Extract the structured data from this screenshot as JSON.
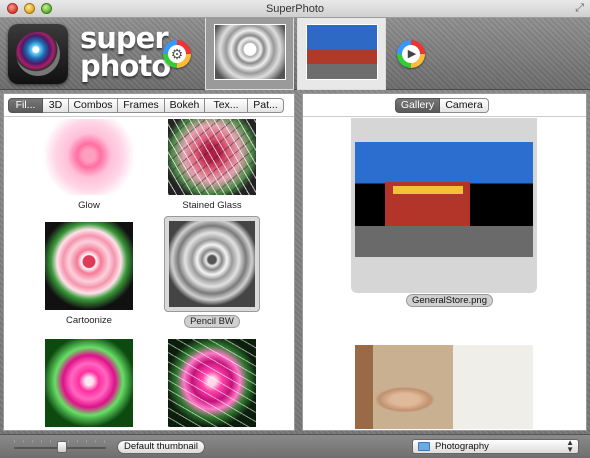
{
  "window": {
    "title": "SuperPhoto",
    "fullscreen_icon": "arrows-diagonal-icon"
  },
  "app": {
    "name_line1": "super",
    "name_line2": "photo",
    "logo_icon": "camera-lens-icon"
  },
  "toolbar": {
    "settings_icon": "gear-icon",
    "play_icon": "play-icon",
    "thumb_slots": [
      "current-image-rose",
      "current-image-general-store"
    ]
  },
  "filter_tabs": [
    {
      "label": "Fil...",
      "active": true
    },
    {
      "label": "3D",
      "active": false
    },
    {
      "label": "Combos",
      "active": false
    },
    {
      "label": "Frames",
      "active": false
    },
    {
      "label": "Bokeh",
      "active": false
    },
    {
      "label": "Tex...",
      "active": false
    },
    {
      "label": "Pat...",
      "active": false
    }
  ],
  "filters": [
    {
      "label": "Glow",
      "selected": false
    },
    {
      "label": "Stained Glass",
      "selected": false
    },
    {
      "label": "Cartoonize",
      "selected": false
    },
    {
      "label": "Pencil BW",
      "selected": true
    },
    {
      "label": "",
      "selected": false
    },
    {
      "label": "",
      "selected": false
    }
  ],
  "right_tabs": [
    {
      "label": "Gallery",
      "active": true
    },
    {
      "label": "Camera",
      "active": false
    }
  ],
  "gallery": {
    "items": [
      {
        "filename": "GeneralStore.png"
      },
      {
        "filename": ""
      }
    ]
  },
  "statusbar": {
    "thumbnail_size_fraction": 0.52,
    "default_thumbnail_label": "Default thumbnail",
    "folder": "Photography"
  },
  "colors": {
    "active_tab": "#5e5e5e",
    "toolbar": "#7c7c7c",
    "panel": "#ffffff"
  }
}
